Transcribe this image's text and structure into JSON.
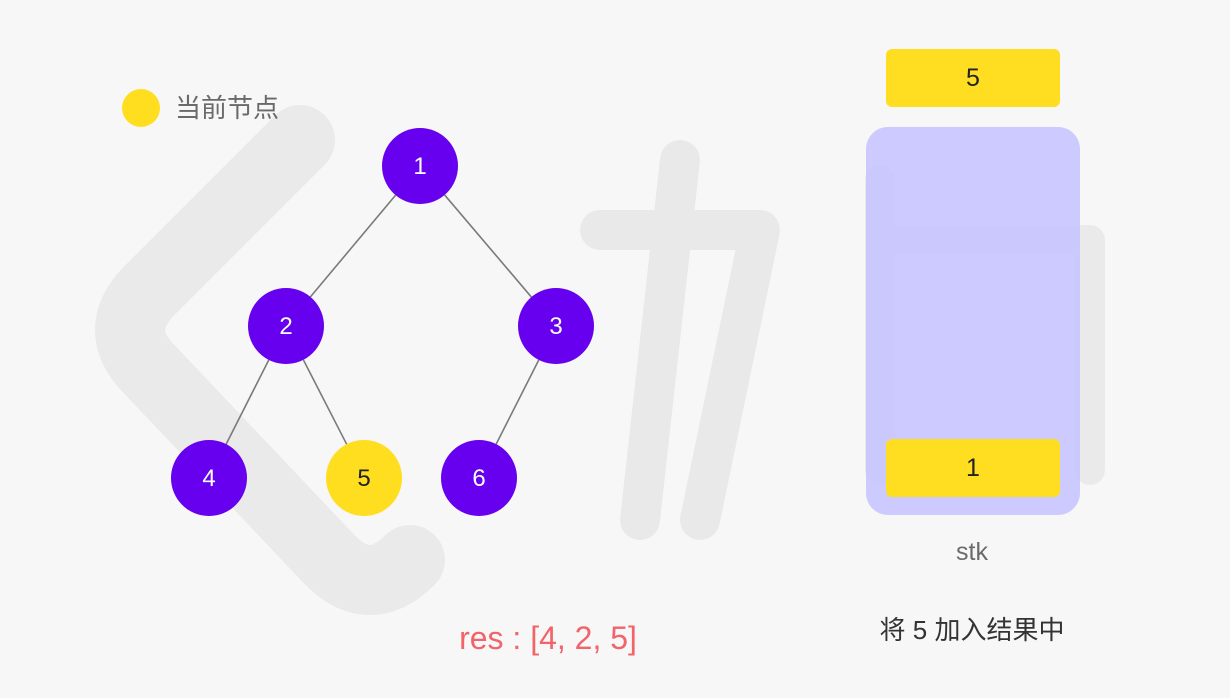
{
  "legend": {
    "label": "当前节点",
    "color": "#ffde1f"
  },
  "tree": {
    "nodes": [
      {
        "id": "n1",
        "label": "1",
        "state": "normal"
      },
      {
        "id": "n2",
        "label": "2",
        "state": "normal"
      },
      {
        "id": "n3",
        "label": "3",
        "state": "normal"
      },
      {
        "id": "n4",
        "label": "4",
        "state": "normal"
      },
      {
        "id": "n5",
        "label": "5",
        "state": "current"
      },
      {
        "id": "n6",
        "label": "6",
        "state": "normal"
      }
    ],
    "edges": [
      [
        "n1",
        "n2"
      ],
      [
        "n1",
        "n3"
      ],
      [
        "n2",
        "n4"
      ],
      [
        "n2",
        "n5"
      ],
      [
        "n3",
        "n6"
      ]
    ],
    "colors": {
      "normal": "#6600ee",
      "current": "#ffde1f",
      "edge": "#7a7a7a"
    }
  },
  "stack": {
    "popped": "5",
    "items": [
      "1"
    ],
    "label": "stk"
  },
  "status": "将 5 加入结果中",
  "result": "res : [4, 2, 5]"
}
